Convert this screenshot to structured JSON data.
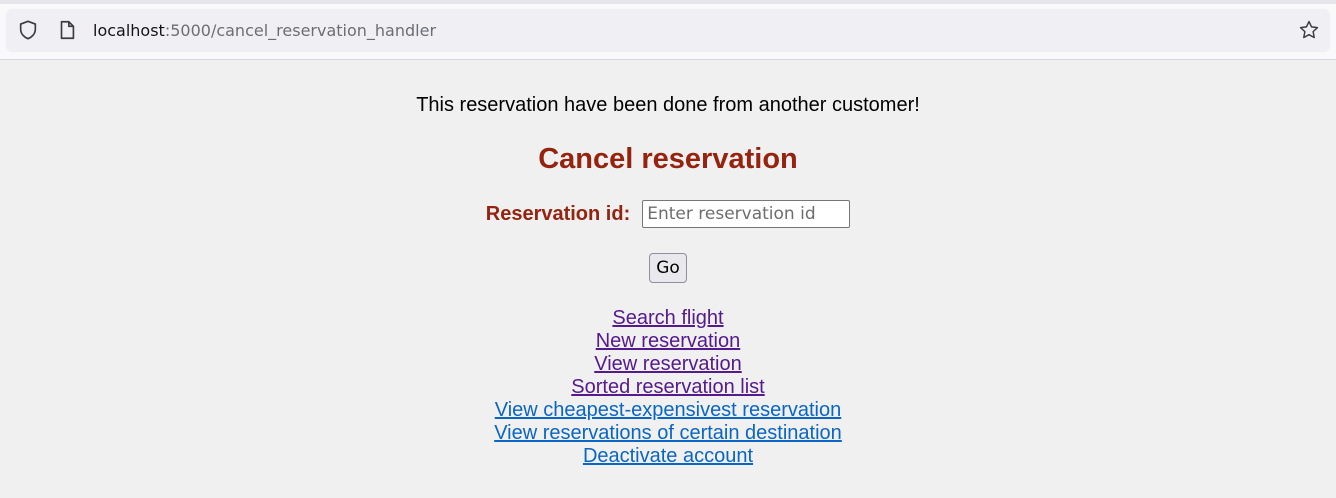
{
  "browser": {
    "url_host": "localhost",
    "url_path": ":5000/cancel_reservation_handler"
  },
  "message": "This reservation have been done from another customer!",
  "title": "Cancel reservation",
  "form": {
    "label": "Reservation id:",
    "placeholder": "Enter reservation id",
    "value": "",
    "submit_label": "Go"
  },
  "links": [
    {
      "label": "Search flight",
      "visited": true
    },
    {
      "label": "New reservation",
      "visited": true
    },
    {
      "label": "View reservation",
      "visited": true
    },
    {
      "label": "Sorted reservation list",
      "visited": true
    },
    {
      "label": "View cheapest-expensivest reservation",
      "visited": false
    },
    {
      "label": "View reservations of certain destination",
      "visited": false
    },
    {
      "label": "Deactivate account",
      "visited": false
    }
  ],
  "colors": {
    "title": "#94240f",
    "visited_link": "#551a8b",
    "unvisited_link": "#0a66c2",
    "background": "#f0f0f0"
  }
}
